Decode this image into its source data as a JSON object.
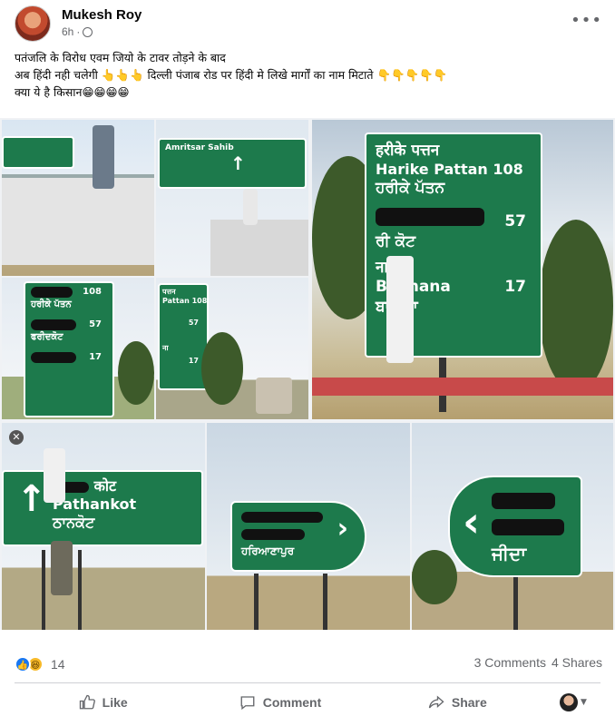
{
  "post": {
    "author": "Mukesh Roy",
    "time": "6h",
    "time_separator": "·",
    "text_lines": [
      "पतंजलि के विरोध एवम जियो के टावर तोड़ने के बाद",
      "अब हिंदी नही चलेगी 👆👆👆 दिल्ली पंजाब रोड पर हिंदी मे लिखे मार्गों का नाम मिटाते 👇👇👇👇👇",
      "क्या ये है किसान😁😁😁😁"
    ]
  },
  "photos": {
    "sign1": {
      "hindi": "हरीके पत्तन",
      "english": "Harike Pattan",
      "distance": "108",
      "punjabi": "ਹਰੀਕੇ ਪੱਤਨ",
      "dist2": "57",
      "fragment": "ਰੀ ਕੋਟ",
      "hindi2": "ना",
      "english2": "Bakhana",
      "dist3": "17",
      "punjabi2": "ਬਾਖਾਨਾ"
    },
    "sign_small1": {
      "line1": "Amritsar Sahib"
    },
    "sign_small2": {
      "line1": "108",
      "line2": "ਹਰੀਕੇ ਪੱਤਨ",
      "dist2": "57",
      "line3": "ਫਰੀਦਕੋਟ",
      "dist3": "17"
    },
    "sign_small3": {
      "line1": "पत्तन",
      "line2": "Pattan 108",
      "dist2": "57",
      "dist3": "17",
      "frag": "ना"
    },
    "sign_pathankot": {
      "hindi": "कोट",
      "english": "Pathankot",
      "punjabi": "ਠਾਨਕੋਟ"
    },
    "sign_hariana": {
      "punjabi": "ਹਰਿਆਣਾਪੁਰ"
    },
    "sign_jeeda": {
      "punjabi": "ਜੀਦਾ"
    }
  },
  "reactions": {
    "count": "14"
  },
  "stats": {
    "comments": "3 Comments",
    "shares": "4 Shares"
  },
  "actions": {
    "like": "Like",
    "comment": "Comment",
    "share": "Share"
  }
}
